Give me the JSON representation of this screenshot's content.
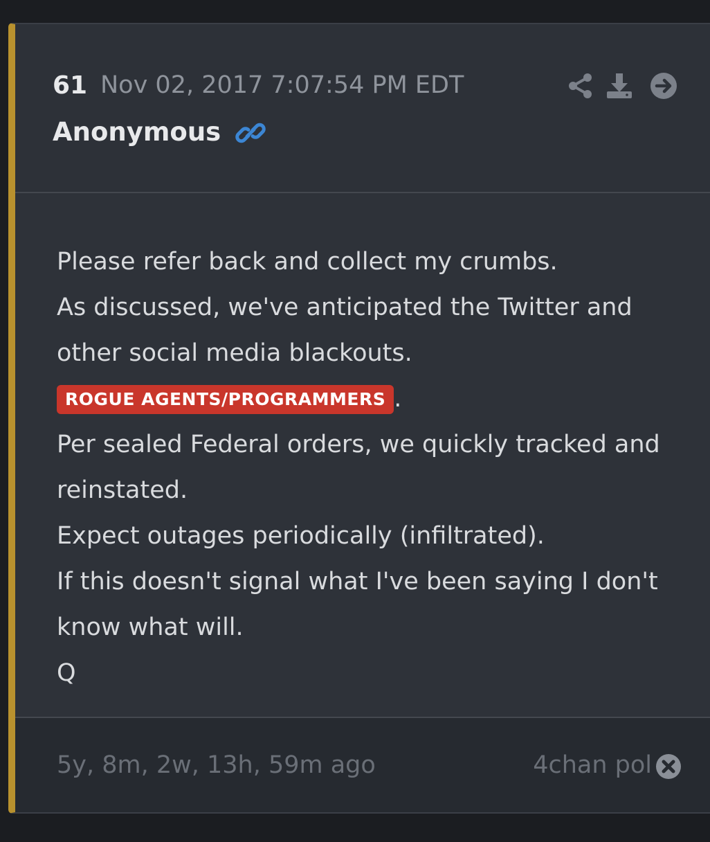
{
  "post": {
    "number": "61",
    "date": "Nov 02, 2017 7:07:54 PM EDT",
    "author": "Anonymous",
    "body_lines": [
      "Please refer back and collect my crumbs.",
      "As discussed, we've anticipated the Twitter and",
      "other social media blackouts.",
      "Per sealed Federal orders, we quickly tracked and",
      "reinstated.",
      "Expect outages periodically (infiltrated).",
      "If this doesn't signal what I've been saying I don't",
      "know what will.",
      "Q"
    ],
    "highlight_tag": "ROGUE AGENTS/PROGRAMMERS",
    "highlight_suffix": ".",
    "time_ago": "5y, 8m, 2w, 13h, 59m ago",
    "source": "4chan pol"
  },
  "icons": {
    "link": "link-icon",
    "share": "share-icon",
    "download": "download-icon",
    "navigate": "arrow-right-circle-icon",
    "close": "close-circle-icon"
  },
  "colors": {
    "accent_bar": "#b8912e",
    "tag_background": "#c9362b",
    "link_icon": "#3c86d4"
  }
}
